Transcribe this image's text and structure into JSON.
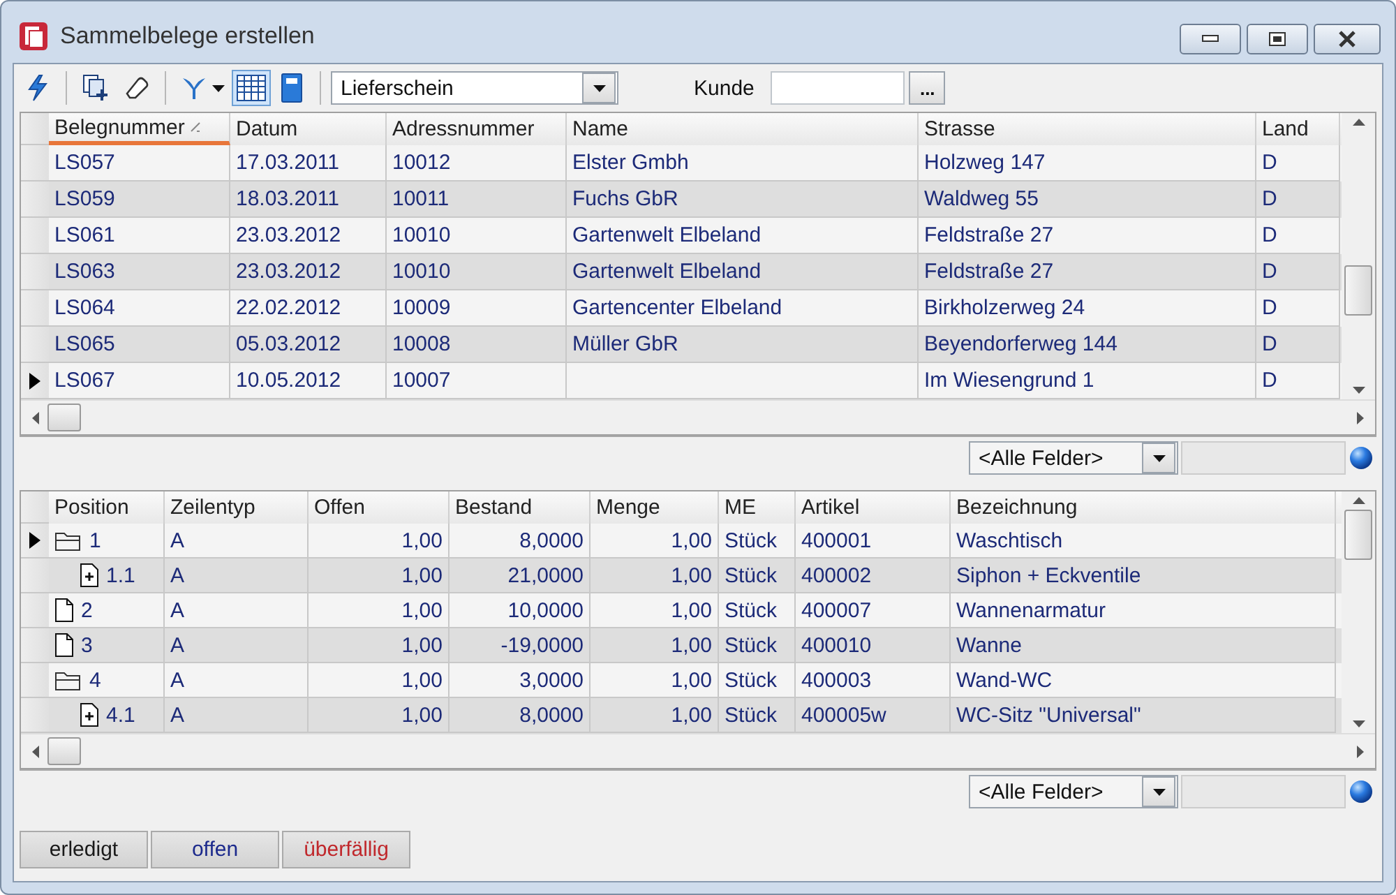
{
  "window": {
    "title": "Sammelbelege erstellen"
  },
  "toolbar": {
    "tools": [
      {
        "kind": "lightning",
        "pressed": false
      },
      {
        "kind": "copy-plus",
        "pressed": false
      },
      {
        "kind": "eraser",
        "pressed": false
      },
      {
        "kind": "filter",
        "pressed": false
      },
      {
        "kind": "grid",
        "pressed": true
      },
      {
        "kind": "book",
        "pressed": false
      }
    ],
    "document_type": {
      "value": "Lieferschein"
    },
    "customer": {
      "label": "Kunde",
      "button": "..."
    }
  },
  "documents": {
    "columns": [
      {
        "label": "Belegnummer",
        "sorted": true
      },
      {
        "label": "Datum",
        "sorted": false
      },
      {
        "label": "Adressnummer",
        "sorted": false
      },
      {
        "label": "Name",
        "sorted": false
      },
      {
        "label": "Strasse",
        "sorted": false
      },
      {
        "label": "Land",
        "sorted": false
      }
    ],
    "rows": [
      {
        "current": false,
        "cells": [
          "LS057",
          "17.03.2011",
          "10012",
          "Elster Gmbh",
          "Holzweg 147",
          "D"
        ]
      },
      {
        "current": false,
        "cells": [
          "LS059",
          "18.03.2011",
          "10011",
          "Fuchs GbR",
          "Waldweg 55",
          "D"
        ]
      },
      {
        "current": false,
        "cells": [
          "LS061",
          "23.03.2012",
          "10010",
          "Gartenwelt Elbeland",
          "Feldstraße 27",
          "D"
        ]
      },
      {
        "current": false,
        "cells": [
          "LS063",
          "23.03.2012",
          "10010",
          "Gartenwelt Elbeland",
          "Feldstraße 27",
          "D"
        ]
      },
      {
        "current": false,
        "cells": [
          "LS064",
          "22.02.2012",
          "10009",
          "Gartencenter Elbeland",
          "Birkholzerweg 24",
          "D"
        ]
      },
      {
        "current": false,
        "cells": [
          "LS065",
          "05.03.2012",
          "10008",
          "Müller GbR",
          "Beyendorferweg 144",
          "D"
        ]
      },
      {
        "current": true,
        "cells": [
          "LS067",
          "10.05.2012",
          "10007",
          "",
          "Im Wiesengrund 1",
          "D"
        ]
      }
    ],
    "filter": {
      "value": "<Alle Felder>"
    }
  },
  "positions": {
    "columns": [
      {
        "label": "Position",
        "sorted": false
      },
      {
        "label": "Zeilentyp",
        "sorted": false
      },
      {
        "label": "Offen",
        "sorted": false
      },
      {
        "label": "Bestand",
        "sorted": false
      },
      {
        "label": "Menge",
        "sorted": false
      },
      {
        "label": "ME",
        "sorted": false
      },
      {
        "label": "Artikel",
        "sorted": false
      },
      {
        "label": "Bezeichnung",
        "sorted": false
      }
    ],
    "rows": [
      {
        "kind": "folder",
        "current": true,
        "cells": [
          "1",
          "A",
          "1,00",
          "8,0000",
          "1,00",
          "Stück",
          "400001",
          "Waschtisch"
        ],
        "children": [
          {
            "kind": "document-plus",
            "current": false,
            "cells": [
              "1.1",
              "A",
              "1,00",
              "21,0000",
              "1,00",
              "Stück",
              "400002",
              "Siphon + Eckventile"
            ]
          }
        ]
      },
      {
        "kind": "document",
        "current": false,
        "cells": [
          "2",
          "A",
          "1,00",
          "10,0000",
          "1,00",
          "Stück",
          "400007",
          "Wannenarmatur"
        ]
      },
      {
        "kind": "document",
        "current": false,
        "cells": [
          "3",
          "A",
          "1,00",
          "-19,0000",
          "1,00",
          "Stück",
          "400010",
          "Wanne"
        ]
      },
      {
        "kind": "folder",
        "current": false,
        "cells": [
          "4",
          "A",
          "1,00",
          "3,0000",
          "1,00",
          "Stück",
          "400003",
          "Wand-WC"
        ],
        "children": [
          {
            "kind": "document-plus",
            "current": false,
            "cells": [
              "4.1",
              "A",
              "1,00",
              "8,0000",
              "1,00",
              "Stück",
              "400005w",
              "WC-Sitz \"Universal\""
            ]
          }
        ]
      }
    ],
    "filter": {
      "value": "<Alle Felder>"
    }
  },
  "status_buttons": [
    {
      "label": "erledigt",
      "color": "#1a1a1a"
    },
    {
      "label": "offen",
      "color": "#1c2a8c"
    },
    {
      "label": "überfällig",
      "color": "#c0282c"
    }
  ]
}
